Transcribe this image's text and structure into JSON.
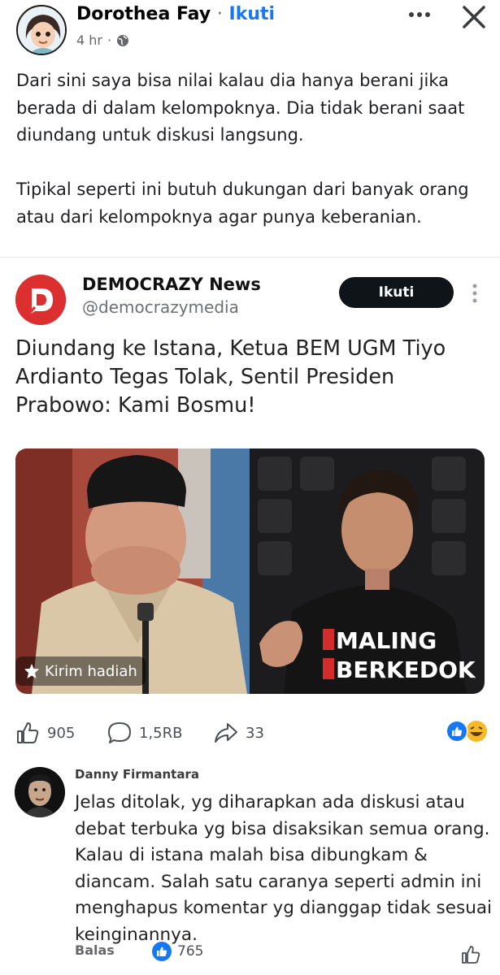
{
  "post": {
    "author": "Dorothea Fay",
    "separator": "·",
    "follow_label": "Ikuti",
    "time": "4 hr",
    "text": "Dari sini saya bisa nilai kalau dia hanya berani jika berada di dalam kelompoknya. Dia tidak berani saat diundang untuk diskusi langsung.\n\nTipikal seperti ini butuh dukungan dari banyak orang atau dari kelompoknya agar punya keberanian."
  },
  "embed": {
    "source_name": "DEMOCRAZY News",
    "source_handle": "@democrazymedia",
    "follow_label": "Ikuti",
    "headline": "Diundang ke Istana, Ketua BEM UGM Tiyo Ardianto Tegas Tolak, Sentil Presiden Prabowo: Kami Bosmu!",
    "gift_label": "Kirim hadiah",
    "shirt_text_line1": "MALING",
    "shirt_text_line2": "BERKEDOK"
  },
  "stats": {
    "likes": "905",
    "comments": "1,5RB",
    "shares": "33"
  },
  "comment": {
    "author": "Danny Firmantara",
    "text": "Jelas ditolak, yg diharapkan ada diskusi atau debat terbuka yg bisa disaksikan semua orang. Kalau di istana malah bisa dibungkam & diancam. Salah satu caranya seperti admin ini menghapus komentar yg dianggap tidak sesuai keinginannya.",
    "reply_label": "Balas",
    "likes": "765"
  },
  "colors": {
    "accent": "#1877f2",
    "source_logo": "#dc2f2f",
    "follow_button": "#0f1419"
  },
  "icons": [
    "more-icon",
    "close-icon",
    "globe-icon",
    "like-icon",
    "comment-icon",
    "share-icon",
    "gift-icon",
    "like-reaction-icon",
    "haha-reaction-icon"
  ]
}
